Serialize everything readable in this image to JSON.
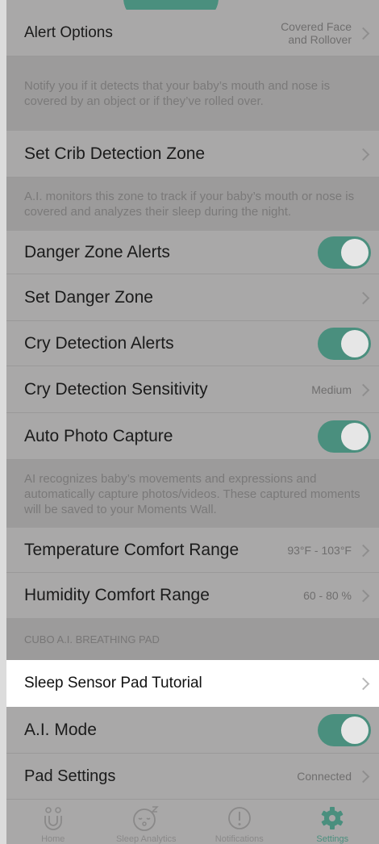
{
  "rows": {
    "alert_options": {
      "label": "Alert Options",
      "value_line1": "Covered Face",
      "value_line2": "and Rollover"
    },
    "alert_desc": "Notify you if it detects that your baby’s mouth and nose is covered by an object or if they’ve rolled over.",
    "crib_zone": {
      "label": "Set Crib Detection Zone"
    },
    "crib_desc": "A.I. monitors this zone to track if your baby’s mouth or nose is covered and analyzes their sleep during the night.",
    "danger_alerts": {
      "label": "Danger Zone Alerts",
      "on": true
    },
    "danger_zone": {
      "label": "Set Danger Zone"
    },
    "cry_alerts": {
      "label": "Cry Detection Alerts",
      "on": true
    },
    "cry_sensitivity": {
      "label": "Cry Detection Sensitivity",
      "value": "Medium"
    },
    "auto_photo": {
      "label": "Auto Photo Capture",
      "on": true
    },
    "photo_desc": "AI recognizes baby’s movements and expressions and automatically capture photos/videos. These captured moments will be saved to your Moments Wall.",
    "temperature": {
      "label": "Temperature Comfort Range",
      "value": "93°F - 103°F"
    },
    "humidity": {
      "label": "Humidity Comfort Range",
      "value": "60 - 80 %"
    },
    "section_pad": "CUBO A.I. BREATHING PAD",
    "pad_tutorial": {
      "label": "Sleep Sensor Pad Tutorial"
    },
    "ai_mode": {
      "label": "A.I. Mode",
      "on": true
    },
    "pad_settings": {
      "label": "Pad Settings",
      "value": "Connected"
    }
  },
  "tabbar": {
    "home": "Home",
    "sleep_analytics": "Sleep Analytics",
    "notifications": "Notifications",
    "settings": "Settings"
  },
  "colors": {
    "accent": "#4a8f7e",
    "overlay_row": "#a9a8a8",
    "overlay_desc": "#9c9b9b",
    "white_row": "#ffffff"
  }
}
